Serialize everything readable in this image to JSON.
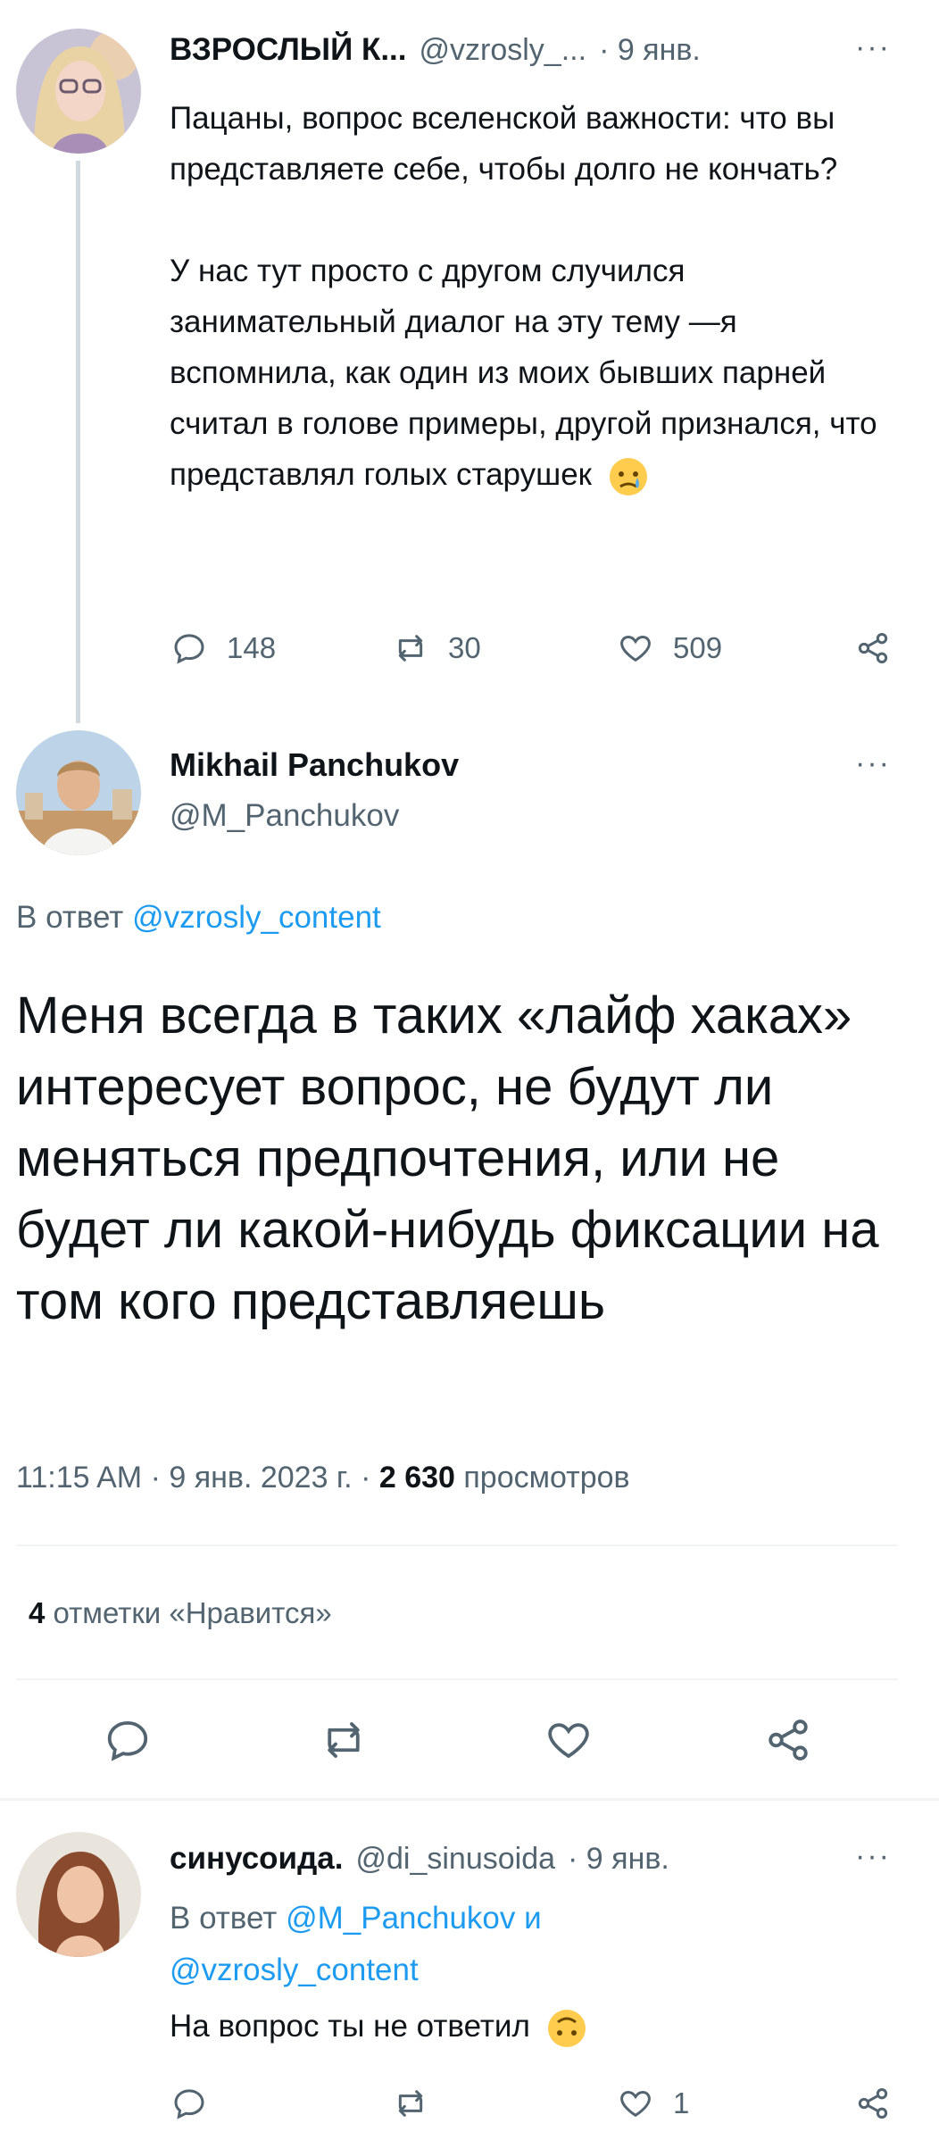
{
  "tweet1": {
    "name": "ВЗРОСЛЫЙ К...",
    "handle": "@vzrosly_...",
    "date": "· 9 янв.",
    "more": "···",
    "text_p1": "Пацаны, вопрос вселенской важности: что вы представляете себе, чтобы долго не кончать?",
    "text_p2": "У нас тут просто с другом случился занимательный диалог на эту тему —я вспомнила, как один из моих бывших парней считал в голове примеры, другой признался, что представлял голых старушек",
    "emoji": "crying-face-emoji",
    "replies": "148",
    "retweets": "30",
    "likes": "509"
  },
  "main_tweet": {
    "name": "Mikhail Panchukov",
    "handle": "@M_Panchukov",
    "more": "···",
    "reply_prefix": "В ответ",
    "reply_to": "@vzrosly_content",
    "text": "Меня всегда в таких «лайф хаках» интересует вопрос, не будут ли меняться предпочтения, или не будет ли какой-нибудь фиксации на том кого представляешь",
    "meta_time": "11:15 AM · 9 янв. 2023 г. · ",
    "views_count": "2 630",
    "views_label": " просмотров",
    "likes_count": "4",
    "likes_label": " отметки «Нравится»"
  },
  "tweet3": {
    "name": "синусоида.",
    "handle": "@di_sinusoida",
    "date": "· 9 янв.",
    "more": "···",
    "reply_prefix": "В ответ",
    "reply_to_1": "@M_Panchukov",
    "reply_and": " и",
    "reply_to_2": "@vzrosly_content",
    "text": "На вопрос ты не ответил",
    "emoji": "upside-down-face-emoji",
    "likes": "1"
  },
  "colors": {
    "text": "#0f1419",
    "muted": "#536471",
    "accent": "#1d9bf0",
    "divider": "#eff3f4",
    "thread_line": "#cfd9de"
  }
}
